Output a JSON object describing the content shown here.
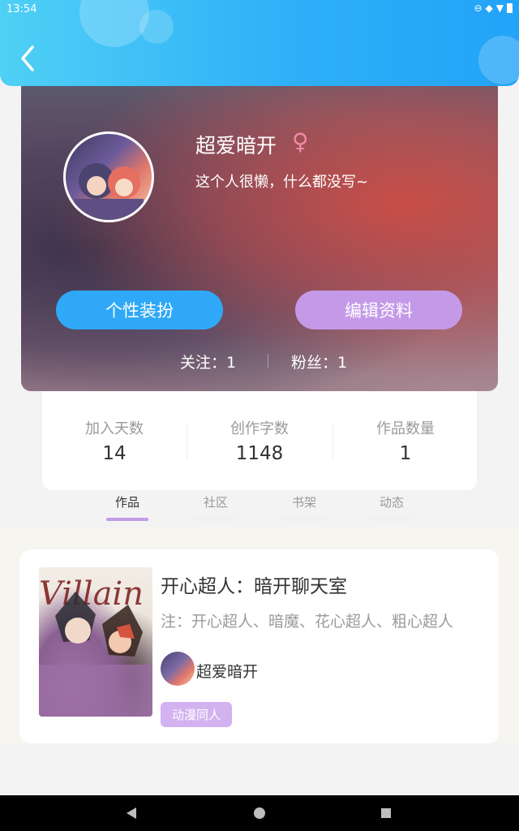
{
  "status_bar": {
    "time": "13:54"
  },
  "profile": {
    "username": "超爱暗开",
    "gender_symbol": "♀",
    "bio": "这个人很懒，什么都没写~",
    "buttons": {
      "dress_up": "个性装扮",
      "edit_profile": "编辑资料"
    },
    "following_label": "关注：1",
    "followers_label": "粉丝：1"
  },
  "stats": [
    {
      "label": "加入天数",
      "value": "14"
    },
    {
      "label": "创作字数",
      "value": "1148"
    },
    {
      "label": "作品数量",
      "value": "1"
    }
  ],
  "tabs": [
    "作品",
    "社区",
    "书架",
    "动态"
  ],
  "active_tab": "作品",
  "work": {
    "cover_text": "Villain",
    "title": "开心超人：暗开聊天室",
    "description": "注：开心超人、暗魔、花心超人、粗心超人",
    "author": "超爱暗开",
    "tag": "动漫同人"
  },
  "colors": {
    "header_blue": "#2fb0f8",
    "accent_purple": "#c49ae8",
    "dress_button_blue": "#2fa8f7",
    "gender_pink": "#f08aa8"
  }
}
